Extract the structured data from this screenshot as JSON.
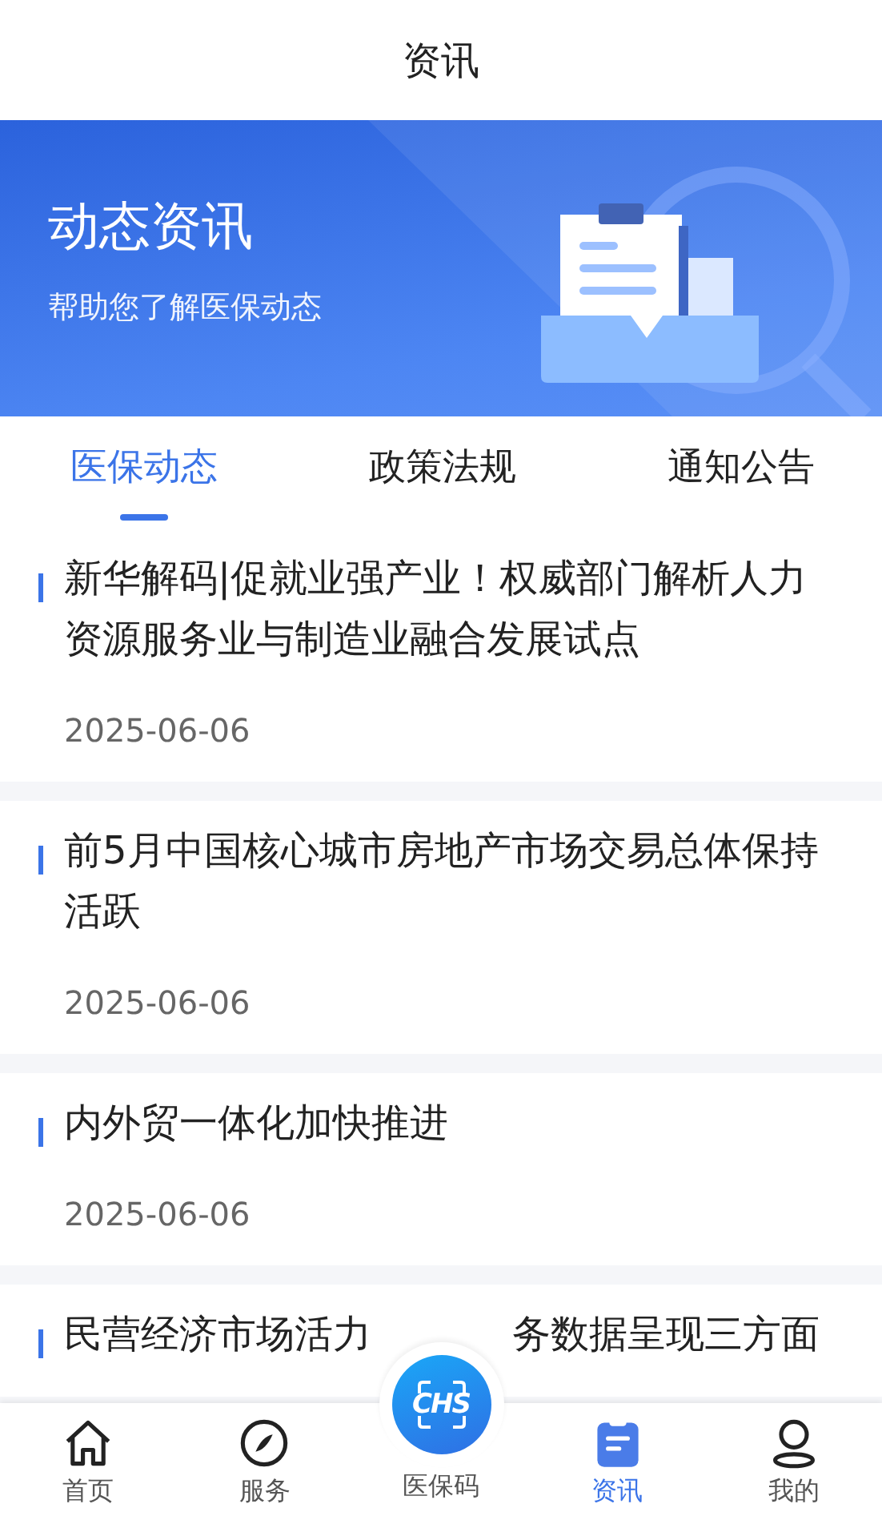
{
  "header": {
    "title": "资讯"
  },
  "banner": {
    "title": "动态资讯",
    "subtitle": "帮助您了解医保动态"
  },
  "tabs": [
    {
      "label": "医保动态",
      "selected": true
    },
    {
      "label": "政策法规",
      "selected": false
    },
    {
      "label": "通知公告",
      "selected": false
    }
  ],
  "articles": [
    {
      "title_parts": [
        "新华解码|促就业强产业！权威部门解析人力资源服务业与制造业融合发展试点"
      ],
      "date": "2025-06-06"
    },
    {
      "title_parts": [
        "前5月中国核心城市房地产市场交易总体保持活跃"
      ],
      "date": "2025-06-06"
    },
    {
      "title_parts": [
        "内外贸一体化加快推进"
      ],
      "date": "2025-06-06"
    },
    {
      "title_parts": [
        "民营经济市场活力",
        "务数据呈现三方面"
      ]
    }
  ],
  "bottom_nav": [
    {
      "kind": "home",
      "label": "首页",
      "selected": false
    },
    {
      "kind": "compass",
      "label": "服务",
      "selected": false
    },
    {
      "kind": "code",
      "label": "医保码",
      "logo_text": "CHS",
      "selected": false
    },
    {
      "kind": "news",
      "label": "资讯",
      "selected": true
    },
    {
      "kind": "user",
      "label": "我的",
      "selected": false
    }
  ]
}
